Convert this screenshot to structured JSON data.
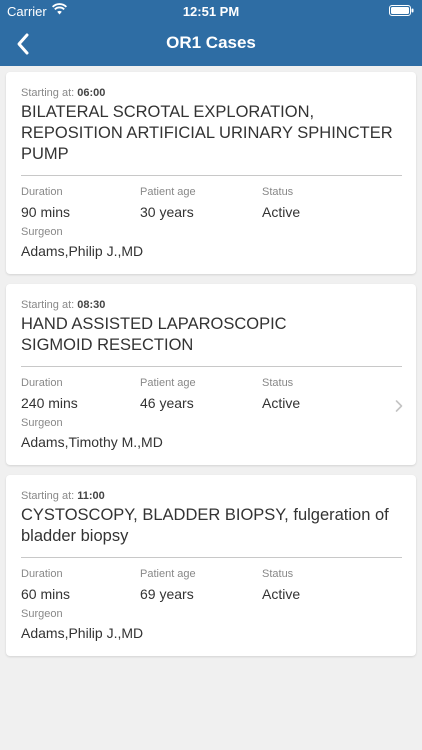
{
  "status_bar": {
    "carrier": "Carrier",
    "time": "12:51 PM"
  },
  "nav": {
    "title": "OR1 Cases"
  },
  "labels": {
    "starting_at": "Starting at:",
    "duration": "Duration",
    "patient_age": "Patient age",
    "status": "Status",
    "surgeon": "Surgeon"
  },
  "cases": [
    {
      "start_time": "06:00",
      "procedure_lines": [
        "BILATERAL SCROTAL EXPLORATION,",
        "REPOSITION ARTIFICIAL URINARY SPHINCTER",
        "PUMP"
      ],
      "duration": "90 mins",
      "patient_age": "30 years",
      "status": "Active",
      "surgeon": "Adams,Philip J.,MD"
    },
    {
      "start_time": "08:30",
      "procedure_lines": [
        "HAND ASSISTED LAPAROSCOPIC",
        "SIGMOID RESECTION"
      ],
      "duration": "240 mins",
      "patient_age": "46 years",
      "status": "Active",
      "surgeon": "Adams,Timothy M.,MD"
    },
    {
      "start_time": "11:00",
      "procedure_lines": [
        "CYSTOSCOPY, BLADDER BIOPSY, fulgeration of",
        "bladder biopsy"
      ],
      "duration": "60 mins",
      "patient_age": "69 years",
      "status": "Active",
      "surgeon": "Adams,Philip J.,MD"
    }
  ]
}
